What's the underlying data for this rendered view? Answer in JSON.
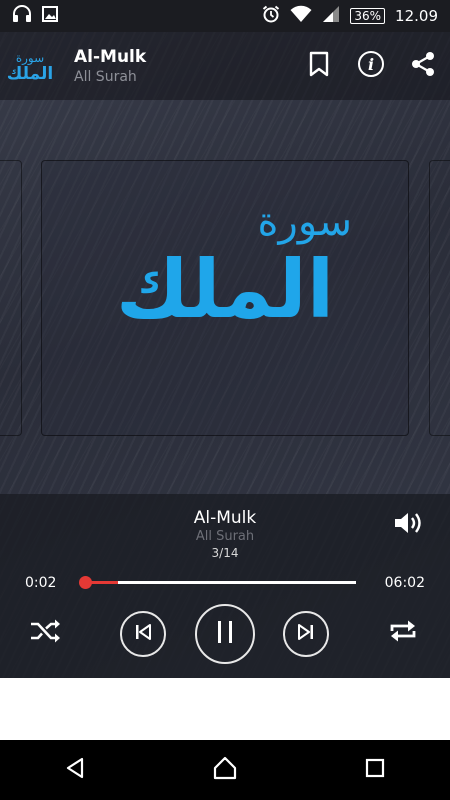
{
  "status_bar": {
    "icons": [
      "headphones-icon",
      "image-icon",
      "alarm-icon",
      "wifi-icon",
      "signal-icon"
    ],
    "battery": "36%",
    "time": "12.09"
  },
  "app_bar": {
    "logo_line1": "سورة",
    "logo_line2": "الملك",
    "title": "Al-Mulk",
    "subtitle": "All Surah",
    "actions": [
      "bookmark-icon",
      "info-icon",
      "share-icon"
    ]
  },
  "artwork": {
    "line1": "سورة",
    "line2": "الملك"
  },
  "player": {
    "title": "Al-Mulk",
    "subtitle": "All Surah",
    "track_count": "3/14",
    "time_current": "0:02",
    "time_total": "06:02",
    "progress": 0.01,
    "buffered": 0.13,
    "controls": [
      "shuffle-icon",
      "previous-icon",
      "pause-icon",
      "next-icon",
      "repeat-icon",
      "volume-icon"
    ]
  },
  "colors": {
    "accent": "#1fa6ea",
    "progress": "#e53935"
  },
  "nav_bar": [
    "back-icon",
    "home-icon",
    "recents-icon"
  ]
}
